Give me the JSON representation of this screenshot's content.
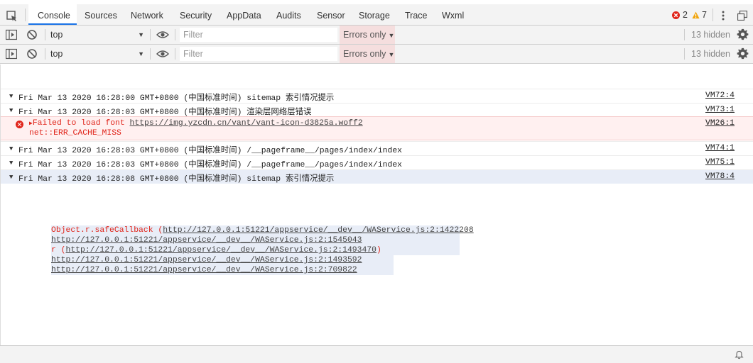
{
  "tabs": {
    "items": [
      "Console",
      "Sources",
      "Network",
      "Security",
      "AppData",
      "Audits",
      "Sensor",
      "Storage",
      "Trace",
      "Wxml"
    ],
    "active": "Console"
  },
  "status": {
    "errors": "2",
    "warnings": "7"
  },
  "toolbar": {
    "context": "top",
    "filter_placeholder": "Filter",
    "levels": "Errors only",
    "hidden": "13 hidden"
  },
  "log": [
    {
      "text": "Fri Mar 13 2020 16:28:00 GMT+0800 (中国标准时间) sitemap 索引情况提示",
      "source": "VM72:4"
    },
    {
      "text": "Fri Mar 13 2020 16:28:03 GMT+0800 (中国标准时间) 渲染层网络层错误",
      "source": "VM73:1"
    },
    {
      "text": "Failed to load font",
      "url": "https://img.yzcdn.cn/vant/vant-icon-d3825a.woff2",
      "detail": "net::ERR_CACHE_MISS",
      "source": "VM26:1"
    },
    {
      "text": "Fri Mar 13 2020 16:28:03 GMT+0800 (中国标准时间) /__pageframe__/pages/index/index",
      "source": "VM74:1"
    },
    {
      "text": "Fri Mar 13 2020 16:28:03 GMT+0800 (中国标准时间) /__pageframe__/pages/index/index",
      "source": "VM75:1"
    },
    {
      "text": "Fri Mar 13 2020 16:28:08 GMT+0800 (中国标准时间) sitemap 索引情况提示",
      "source": "VM78:4"
    }
  ],
  "stack": [
    {
      "prefix": "Object.r.safeCallback (",
      "link": "http://127.0.0.1:51221/appservice/__dev__/WAService.js:2:1422208",
      "suffix": ""
    },
    {
      "prefix": "",
      "link": "http://127.0.0.1:51221/appservice/__dev__/WAService.js:2:1545043",
      "suffix": ""
    },
    {
      "prefix": "r (",
      "link": "http://127.0.0.1:51221/appservice/__dev__/WAService.js:2:1493470",
      "suffix": ")"
    },
    {
      "prefix": "",
      "link": "http://127.0.0.1:51221/appservice/__dev__/WAService.js:2:1493592",
      "suffix": ""
    },
    {
      "prefix": "",
      "link": "http://127.0.0.1:51221/appservice/__dev__/WAService.js:2:709822",
      "suffix": ""
    }
  ],
  "colors": {
    "accent": "#1a73e8",
    "error": "#e0241a",
    "warning": "#f0a30a",
    "levels_bg": "#f5dede"
  }
}
